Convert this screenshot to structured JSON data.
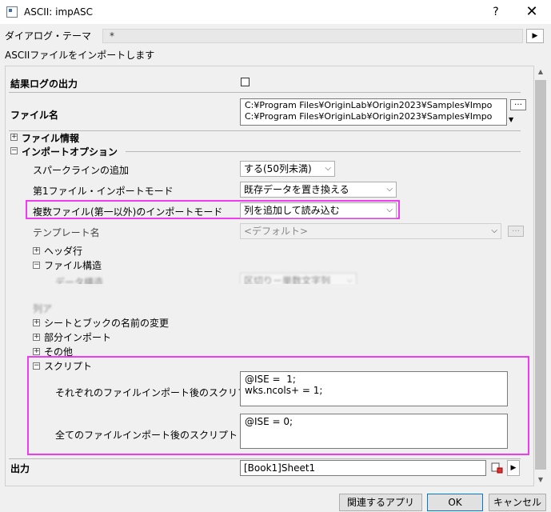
{
  "window": {
    "title": "ASCII: impASC",
    "help": "?",
    "close": "✕"
  },
  "theme": {
    "label": "ダイアログ・テーマ",
    "value": "*",
    "arrow": "▶"
  },
  "description": "ASCIIファイルをインポートします",
  "log": {
    "label": "結果ログの出力",
    "checked": false
  },
  "filename": {
    "label": "ファイル名",
    "lines": [
      "C:¥Program Files¥OriginLab¥Origin2023¥Samples¥Impo",
      "C:¥Program Files¥OriginLab¥Origin2023¥Samples¥Impo"
    ]
  },
  "fileinfo": {
    "toggle": "+",
    "label": "ファイル情報"
  },
  "import_options": {
    "toggle": "−",
    "label": "インポートオプション",
    "sparkline": {
      "label": "スパークラインの追加",
      "value": "する(50列未満)"
    },
    "first_mode": {
      "label": "第1ファイル・インポートモード",
      "value": "既存データを置き換える"
    },
    "multi_mode": {
      "label": "複数ファイル(第一以外)のインポートモード",
      "value": "列を追加して読み込む"
    },
    "template": {
      "label": "テンプレート名",
      "value": "<デフォルト>"
    },
    "header": {
      "toggle": "+",
      "label": "ヘッダ行"
    },
    "file_struct": {
      "toggle": "−",
      "label": "ファイル構造",
      "data_struct_label": "データ構造",
      "data_struct_value": "区切り－単数文字列"
    },
    "column": {
      "label": "列ア"
    },
    "rename": {
      "toggle": "+",
      "label": "シートとブックの名前の変更"
    },
    "partial": {
      "toggle": "+",
      "label": "部分インポート"
    },
    "other": {
      "toggle": "+",
      "label": "その他"
    },
    "script": {
      "toggle": "−",
      "label": "スクリプト",
      "each_label": "それぞれのファイルインポート後のスクリプト",
      "each_value": "@ISE =  1;\nwks.ncols+ = 1;",
      "all_label": "全てのファイルインポート後のスクリプト",
      "all_value": "@ISE = 0;"
    }
  },
  "output": {
    "label": "出力",
    "value": "[Book1]Sheet1"
  },
  "buttons": {
    "related": "関連するアプリ",
    "ok": "OK",
    "cancel": "キャンセル"
  },
  "colors": {
    "highlight": "#f03cf0",
    "panel_bg": "#f0f0f0"
  }
}
